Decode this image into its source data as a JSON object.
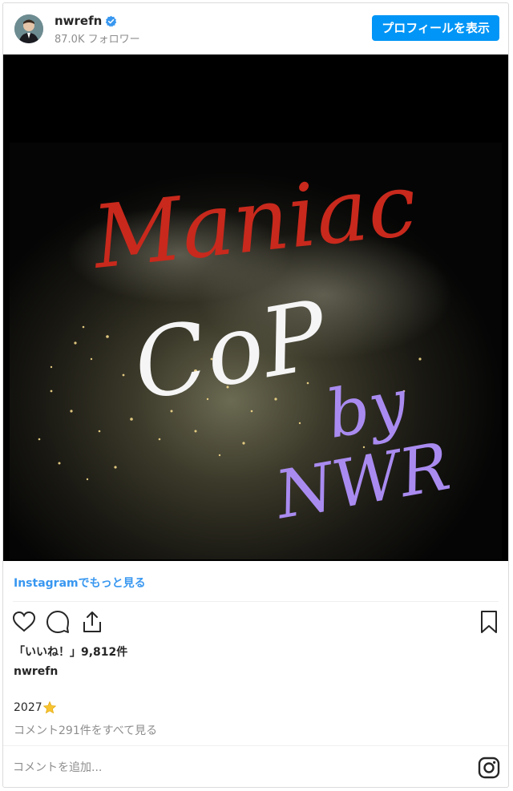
{
  "header": {
    "username": "nwrefn",
    "followers": "87.0K フォロワー",
    "profile_button": "プロフィールを表示"
  },
  "post": {
    "image_text": {
      "line1": "Maniac",
      "line2": "CoP",
      "line3": "by",
      "line4": "NWR"
    },
    "more_link": "Instagramでもっと見る",
    "likes": "「いいね！」9,812件",
    "caption_user": "nwrefn",
    "caption_text": "2027",
    "caption_emoji_icon": "star-icon",
    "view_comments": "コメント291件をすべて見る"
  },
  "comment": {
    "placeholder": "コメントを追加..."
  },
  "colors": {
    "accent": "#0095f6",
    "link": "#3897f0",
    "title_red": "#c8291c",
    "title_purple": "#a98bf0"
  }
}
